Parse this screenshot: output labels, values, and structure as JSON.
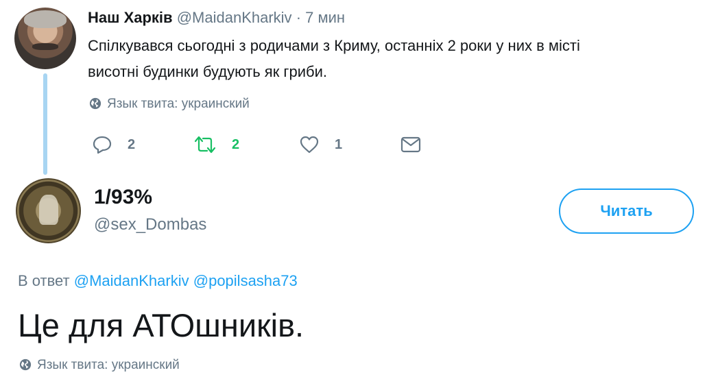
{
  "parent_tweet": {
    "display_name": "Наш Харків",
    "handle": "@MaidanKharkiv",
    "separator": "·",
    "time": "7 мин",
    "text_line1": "Спілкувався сьогодні з родичами з Криму, останніх 2 роки у них в місті",
    "text_line2": "висотні будинки будують як гриби.",
    "language": "Язык твита: украинский",
    "actions": {
      "replies": "2",
      "retweets": "2",
      "likes": "1"
    }
  },
  "user_card": {
    "display_name": "1/93%",
    "handle": "@sex_Dombas",
    "follow_label": "Читать"
  },
  "reply_tweet": {
    "reply_prefix": "В ответ",
    "mentions": [
      "@MaidanKharkiv",
      "@popilsasha73"
    ],
    "text": "Це для АТОшників.",
    "language": "Язык твита: украинский"
  },
  "colors": {
    "accent": "#1da1f2",
    "retweet_green": "#17bf63",
    "secondary_text": "#657786",
    "thread_line": "#a8d5f2"
  },
  "icons": [
    "globe-icon",
    "reply-icon",
    "retweet-icon",
    "like-icon",
    "direct-message-icon"
  ]
}
